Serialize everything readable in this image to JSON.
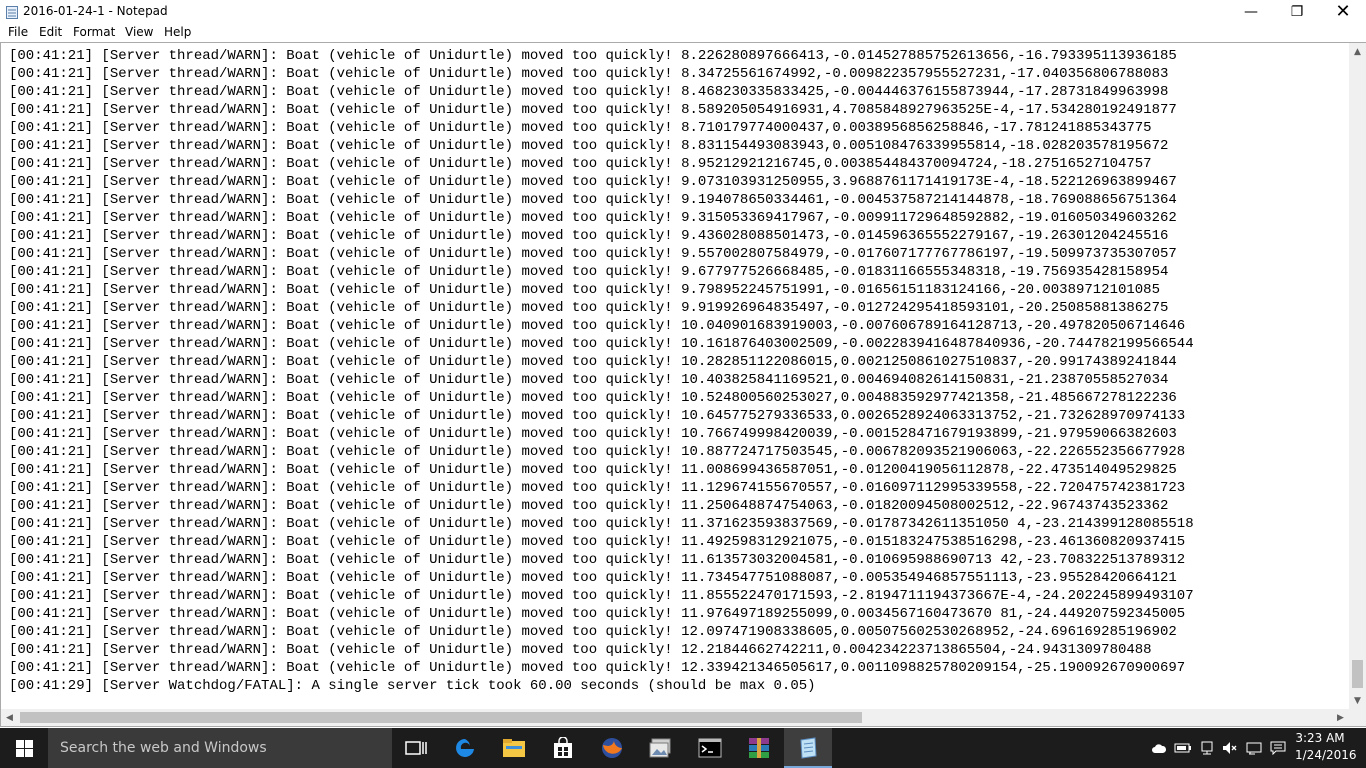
{
  "window": {
    "title": "2016-01-24-1 - Notepad",
    "controls": {
      "minimize": "—",
      "maximize": "❐",
      "close": "✕"
    }
  },
  "menu": [
    "File",
    "Edit",
    "Format",
    "View",
    "Help"
  ],
  "log_lines": [
    "[00:41:21] [Server thread/WARN]: Boat (vehicle of Unidurtle) moved too quickly! 8.226280897666413,-0.014527885752613656,-16.793395113936185",
    "[00:41:21] [Server thread/WARN]: Boat (vehicle of Unidurtle) moved too quickly! 8.34725561674992,-0.009822357955527231,-17.040356806788083",
    "[00:41:21] [Server thread/WARN]: Boat (vehicle of Unidurtle) moved too quickly! 8.468230335833425,-0.004446376155873944,-17.28731849963998",
    "[00:41:21] [Server thread/WARN]: Boat (vehicle of Unidurtle) moved too quickly! 8.589205054916931,4.7085848927963525E-4,-17.534280192491877",
    "[00:41:21] [Server thread/WARN]: Boat (vehicle of Unidurtle) moved too quickly! 8.710179774000437,0.0038956856258846,-17.781241885343775",
    "[00:41:21] [Server thread/WARN]: Boat (vehicle of Unidurtle) moved too quickly! 8.831154493083943,0.005108476339955814,-18.028203578195672",
    "[00:41:21] [Server thread/WARN]: Boat (vehicle of Unidurtle) moved too quickly! 8.95212921216745,0.003854484370094724,-18.27516527104757",
    "[00:41:21] [Server thread/WARN]: Boat (vehicle of Unidurtle) moved too quickly! 9.073103931250955,3.9688761171419173E-4,-18.522126963899467",
    "[00:41:21] [Server thread/WARN]: Boat (vehicle of Unidurtle) moved too quickly! 9.194078650334461,-0.004537587214144878,-18.769088656751364",
    "[00:41:21] [Server thread/WARN]: Boat (vehicle of Unidurtle) moved too quickly! 9.315053369417967,-0.009911729648592882,-19.016050349603262",
    "[00:41:21] [Server thread/WARN]: Boat (vehicle of Unidurtle) moved too quickly! 9.436028088501473,-0.014596365552279167,-19.26301204245516",
    "[00:41:21] [Server thread/WARN]: Boat (vehicle of Unidurtle) moved too quickly! 9.557002807584979,-0.017607177767786197,-19.509973735307057",
    "[00:41:21] [Server thread/WARN]: Boat (vehicle of Unidurtle) moved too quickly! 9.677977526668485,-0.01831166555348318,-19.756935428158954",
    "[00:41:21] [Server thread/WARN]: Boat (vehicle of Unidurtle) moved too quickly! 9.798952245751991,-0.01656151183124166,-20.00389712101085",
    "[00:41:21] [Server thread/WARN]: Boat (vehicle of Unidurtle) moved too quickly! 9.919926964835497,-0.012724295418593101,-20.25085881386275",
    "[00:41:21] [Server thread/WARN]: Boat (vehicle of Unidurtle) moved too quickly! 10.040901683919003,-0.007606789164128713,-20.497820506714646",
    "[00:41:21] [Server thread/WARN]: Boat (vehicle of Unidurtle) moved too quickly! 10.161876403002509,-0.0022839416487840936,-20.744782199566544",
    "[00:41:21] [Server thread/WARN]: Boat (vehicle of Unidurtle) moved too quickly! 10.282851122086015,0.0021250861027510837,-20.99174389241844",
    "[00:41:21] [Server thread/WARN]: Boat (vehicle of Unidurtle) moved too quickly! 10.403825841169521,0.004694082614150831,-21.23870558527034",
    "[00:41:21] [Server thread/WARN]: Boat (vehicle of Unidurtle) moved too quickly! 10.524800560253027,0.004883592977421358,-21.485667278122236",
    "[00:41:21] [Server thread/WARN]: Boat (vehicle of Unidurtle) moved too quickly! 10.645775279336533,0.0026528924063313752,-21.732628970974133",
    "[00:41:21] [Server thread/WARN]: Boat (vehicle of Unidurtle) moved too quickly! 10.766749998420039,-0.001528471679193899,-21.97959066382603",
    "[00:41:21] [Server thread/WARN]: Boat (vehicle of Unidurtle) moved too quickly! 10.887724717503545,-0.006782093521906063,-22.226552356677928",
    "[00:41:21] [Server thread/WARN]: Boat (vehicle of Unidurtle) moved too quickly! 11.008699436587051,-0.01200419056112878,-22.473514049529825",
    "[00:41:21] [Server thread/WARN]: Boat (vehicle of Unidurtle) moved too quickly! 11.129674155670557,-0.016097112995339558,-22.720475742381723",
    "[00:41:21] [Server thread/WARN]: Boat (vehicle of Unidurtle) moved too quickly! 11.250648874754063,-0.01820094508002512,-22.96743743523362",
    "[00:41:21] [Server thread/WARN]: Boat (vehicle of Unidurtle) moved too quickly! 11.371623593837569,-0.01787342611351050 4,-23.214399128085518",
    "[00:41:21] [Server thread/WARN]: Boat (vehicle of Unidurtle) moved too quickly! 11.492598312921075,-0.015183247538516298,-23.461360820937415",
    "[00:41:21] [Server thread/WARN]: Boat (vehicle of Unidurtle) moved too quickly! 11.613573032004581,-0.010695988690713 42,-23.708322513789312",
    "[00:41:21] [Server thread/WARN]: Boat (vehicle of Unidurtle) moved too quickly! 11.734547751088087,-0.005354946857551113,-23.95528420664121",
    "[00:41:21] [Server thread/WARN]: Boat (vehicle of Unidurtle) moved too quickly! 11.855522470171593,-2.8194711194373667E-4,-24.202245899493107",
    "[00:41:21] [Server thread/WARN]: Boat (vehicle of Unidurtle) moved too quickly! 11.976497189255099,0.0034567160473670 81,-24.449207592345005",
    "[00:41:21] [Server thread/WARN]: Boat (vehicle of Unidurtle) moved too quickly! 12.097471908338605,0.005075602530268952,-24.696169285196902",
    "[00:41:21] [Server thread/WARN]: Boat (vehicle of Unidurtle) moved too quickly! 12.21844662742211,0.004234223713865504,-24.9431309780488",
    "[00:41:21] [Server thread/WARN]: Boat (vehicle of Unidurtle) moved too quickly! 12.339421346505617,0.0011098825780209154,-25.190092670900697",
    "[00:41:29] [Server Watchdog/FATAL]: A single server tick took 60.00 seconds (should be max 0.05)"
  ],
  "taskbar": {
    "search_placeholder": "Search the web and Windows",
    "apps": [
      {
        "name": "task-view-icon"
      },
      {
        "name": "edge-icon"
      },
      {
        "name": "file-explorer-icon"
      },
      {
        "name": "store-icon"
      },
      {
        "name": "firefox-icon"
      },
      {
        "name": "photos-icon"
      },
      {
        "name": "command-prompt-icon"
      },
      {
        "name": "winrar-icon"
      },
      {
        "name": "notepad-icon",
        "active": true
      }
    ],
    "clock": {
      "time": "3:23 AM",
      "date": "1/24/2016"
    }
  },
  "colors": {
    "taskbar_bg": "#1c1c1c",
    "search_bg": "#3a3a3a",
    "accent": "#7aa7d9"
  }
}
